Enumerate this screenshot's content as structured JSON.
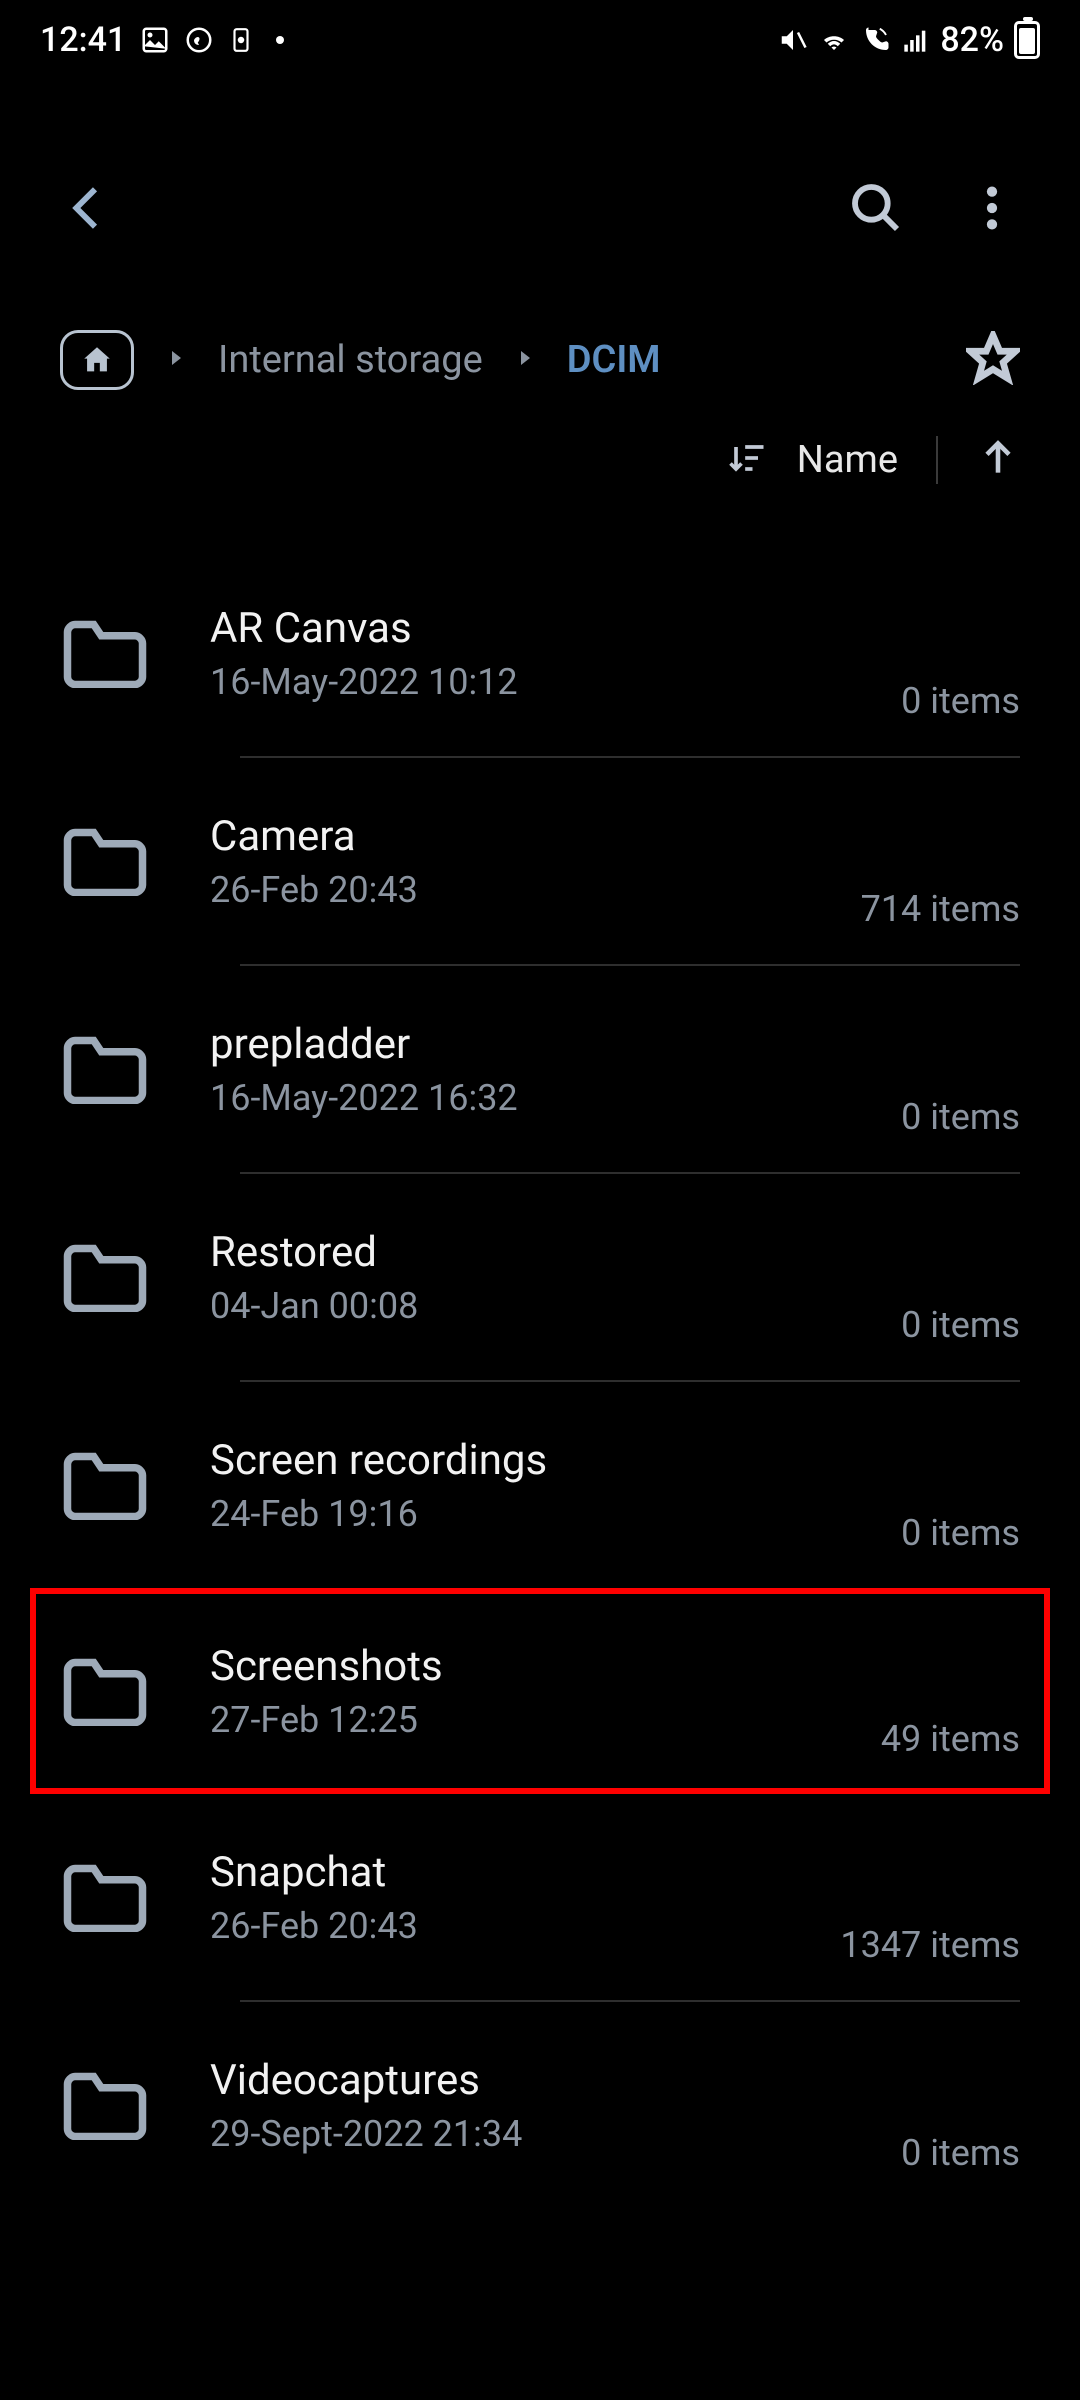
{
  "status_bar": {
    "time": "12:41",
    "battery": "82%"
  },
  "breadcrumb": {
    "level1": "Internal storage",
    "current": "DCIM"
  },
  "sort": {
    "label": "Name"
  },
  "folders": [
    {
      "name": "AR Canvas",
      "date": "16-May-2022 10:12",
      "count": "0 items",
      "highlighted": false
    },
    {
      "name": "Camera",
      "date": "26-Feb 20:43",
      "count": "714 items",
      "highlighted": false
    },
    {
      "name": "prepladder",
      "date": "16-May-2022 16:32",
      "count": "0 items",
      "highlighted": false
    },
    {
      "name": "Restored",
      "date": "04-Jan 00:08",
      "count": "0 items",
      "highlighted": false
    },
    {
      "name": "Screen recordings",
      "date": "24-Feb 19:16",
      "count": "0 items",
      "highlighted": false
    },
    {
      "name": "Screenshots",
      "date": "27-Feb 12:25",
      "count": "49 items",
      "highlighted": true
    },
    {
      "name": "Snapchat",
      "date": "26-Feb 20:43",
      "count": "1347 items",
      "highlighted": false
    },
    {
      "name": "Videocaptures",
      "date": "29-Sept-2022 21:34",
      "count": "0 items",
      "highlighted": false
    }
  ]
}
